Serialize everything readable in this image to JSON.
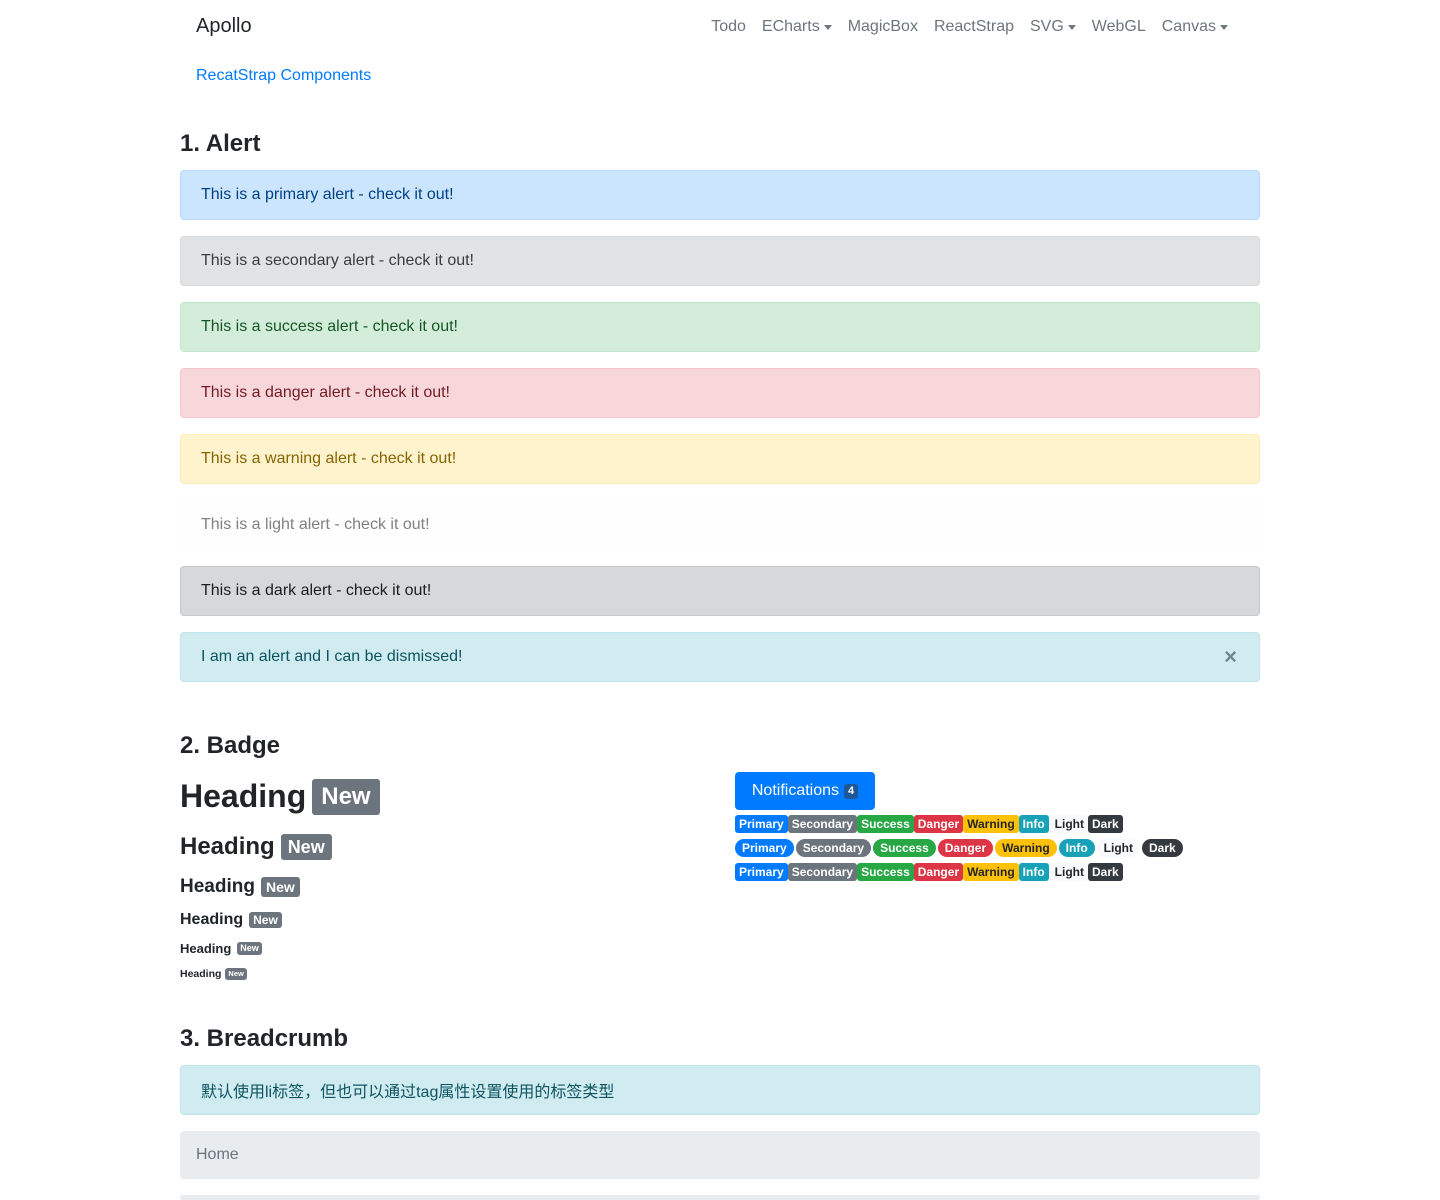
{
  "navbar": {
    "brand": "Apollo",
    "items": [
      {
        "label": "Todo"
      },
      {
        "label": "ECharts"
      },
      {
        "label": "MagicBox"
      },
      {
        "label": "ReactStrap"
      },
      {
        "label": "SVG"
      },
      {
        "label": "WebGL"
      },
      {
        "label": "Canvas"
      }
    ]
  },
  "sublink": "RecatStrap Components",
  "sections": {
    "alert": "1. Alert",
    "badge": "2. Badge",
    "breadcrumb": "3. Breadcrumb"
  },
  "alerts": [
    {
      "text": "This is a primary alert - check it out!",
      "color": "#cce5ff"
    },
    {
      "text": "This is a secondary alert - check it out!",
      "color": "#e2e3e5"
    },
    {
      "text": "This is a success alert - check it out!",
      "color": "#d4edda"
    },
    {
      "text": "This is a danger alert - check it out!",
      "color": "#f8d7da"
    },
    {
      "text": "This is a warning alert - check it out!",
      "color": "#fff3cd"
    },
    {
      "text": "This is a light alert - check it out!",
      "color": "#fefefe"
    },
    {
      "text": "This is a dark alert - check it out!",
      "color": "#d6d8d9"
    },
    {
      "text": "I am an alert and I can be dismissed!",
      "color": "#d1ecf1",
      "close": "×"
    }
  ],
  "badge": {
    "heading": "Heading",
    "new_label": "New",
    "notifications_label": "Notifications",
    "notifications_count": "4",
    "labels": {
      "primary": "Primary",
      "secondary": "Secondary",
      "success": "Success",
      "danger": "Danger",
      "warning": "Warning",
      "info": "Info",
      "light": "Light",
      "dark": "Dark"
    }
  },
  "breadcrumb": {
    "note": "默认使用li标签，但也可以通过tag属性设置使用的标签类型",
    "items": [
      "Home"
    ]
  }
}
